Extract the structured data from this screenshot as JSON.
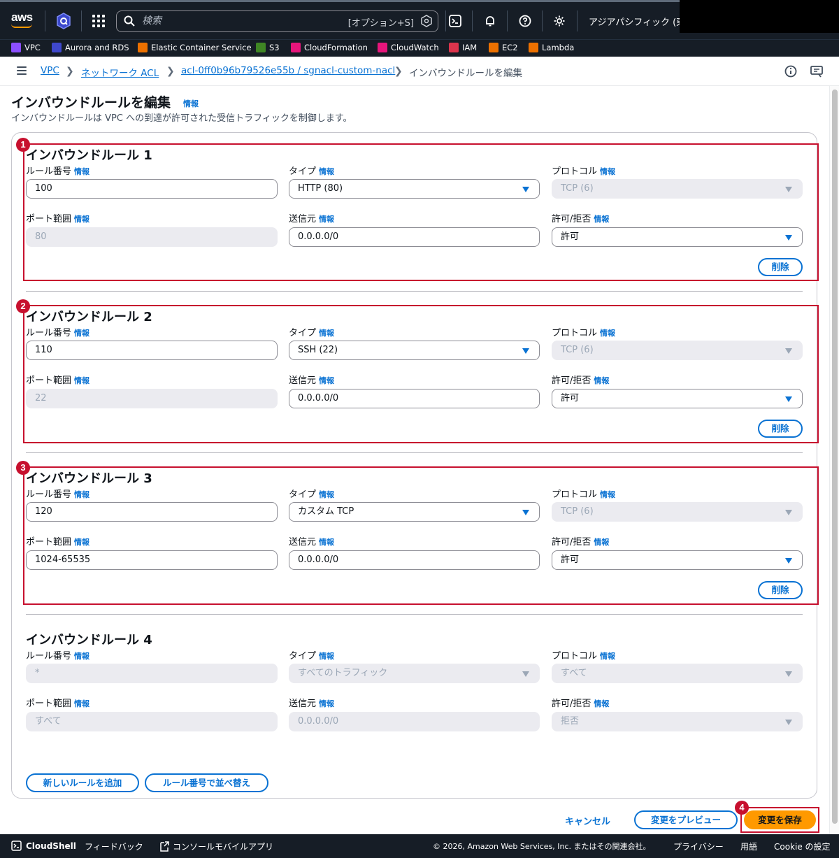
{
  "topbar": {
    "logo": "aws",
    "search_placeholder": "検索",
    "search_shortcut": "[オプション+S]",
    "region": "アジアパシフィック (東京)"
  },
  "favorites": [
    {
      "label": "VPC",
      "color": "#8c4fff"
    },
    {
      "label": "Aurora and RDS",
      "color": "#3f48cc"
    },
    {
      "label": "Elastic Container Service",
      "color": "#ed7100"
    },
    {
      "label": "S3",
      "color": "#3f8624"
    },
    {
      "label": "CloudFormation",
      "color": "#e7157b"
    },
    {
      "label": "CloudWatch",
      "color": "#e7157b"
    },
    {
      "label": "IAM",
      "color": "#dd344c"
    },
    {
      "label": "EC2",
      "color": "#ed7100"
    },
    {
      "label": "Lambda",
      "color": "#ed7100"
    }
  ],
  "breadcrumb": {
    "items": [
      "VPC",
      "ネットワーク ACL",
      "acl-0ff0b96b79526e55b / sgnacl-custom-nacl"
    ],
    "current": "インバウンドルールを編集"
  },
  "page": {
    "title": "インバウンドルールを編集",
    "info": "情報",
    "description": "インバウンドルールは VPC への到達が許可された受信トラフィックを制御します。"
  },
  "labels": {
    "rule_number": "ルール番号",
    "type": "タイプ",
    "protocol": "プロトコル",
    "port_range": "ポート範囲",
    "source": "送信元",
    "allow_deny": "許可/拒否",
    "info": "情報",
    "delete": "削除"
  },
  "rules": [
    {
      "title": "インバウンドルール 1",
      "number": "100",
      "type": "HTTP (80)",
      "protocol": "TCP (6)",
      "port": "80",
      "source": "0.0.0.0/0",
      "action": "許可",
      "badge": "1"
    },
    {
      "title": "インバウンドルール 2",
      "number": "110",
      "type": "SSH (22)",
      "protocol": "TCP (6)",
      "port": "22",
      "source": "0.0.0.0/0",
      "action": "許可",
      "badge": "2"
    },
    {
      "title": "インバウンドルール 3",
      "number": "120",
      "type": "カスタム TCP",
      "protocol": "TCP (6)",
      "port": "1024-65535",
      "source": "0.0.0.0/0",
      "action": "許可",
      "badge": "3"
    },
    {
      "title": "インバウンドルール 4",
      "number": "*",
      "type": "すべてのトラフィック",
      "protocol": "すべて",
      "port": "すべて",
      "source": "0.0.0.0/0",
      "action": "拒否"
    }
  ],
  "actions": {
    "add_rule": "新しいルールを追加",
    "sort": "ルール番号で並べ替え",
    "cancel": "キャンセル",
    "preview": "変更をプレビュー",
    "save": "変更を保存",
    "save_badge": "4"
  },
  "footer": {
    "cloudshell": "CloudShell",
    "feedback": "フィードバック",
    "mobile": "コンソールモバイルアプリ",
    "copyright": "© 2026, Amazon Web Services, Inc. またはその関連会社。",
    "privacy": "プライバシー",
    "terms": "用語",
    "cookie": "Cookie の設定"
  },
  "colors": {
    "accent": "#0972d3",
    "highlight": "#c7102e",
    "primary_button": "#ff9900",
    "topbar": "#161d26"
  }
}
